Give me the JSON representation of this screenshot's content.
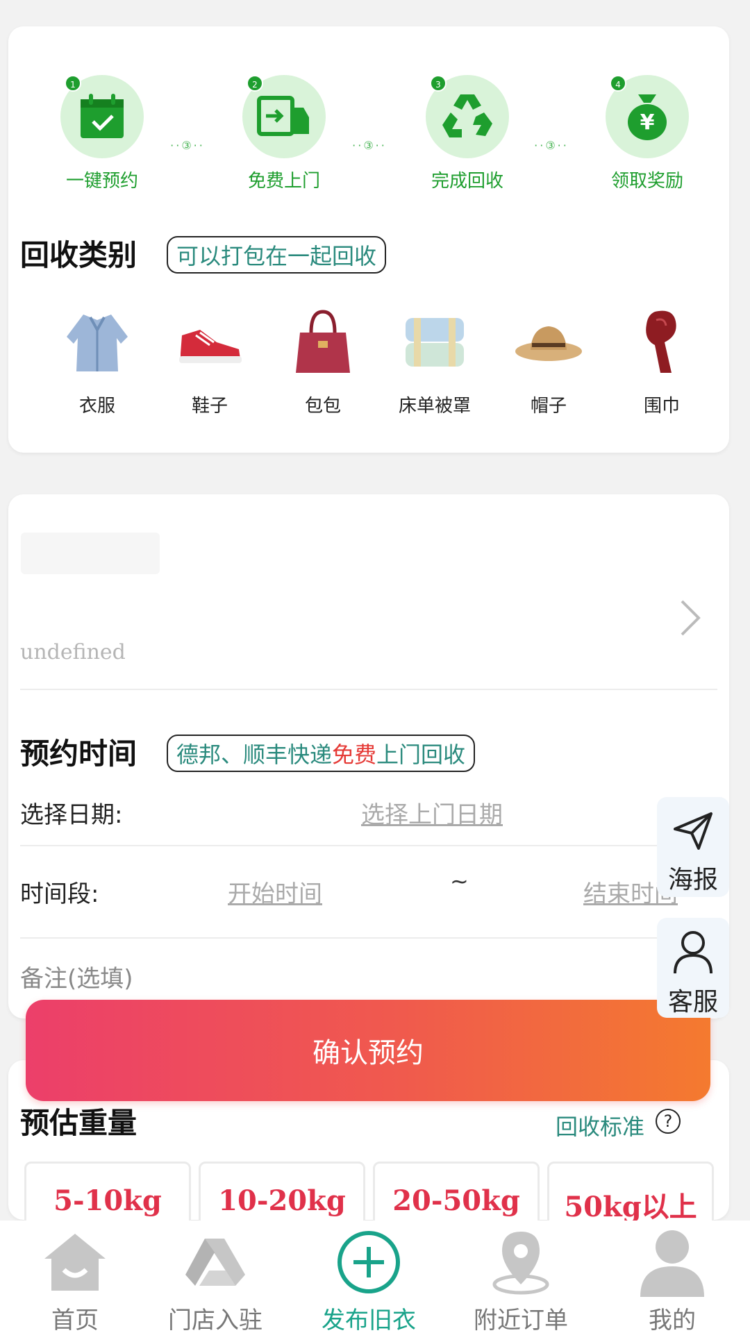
{
  "colors": {
    "accent_green": "#1e9e2e",
    "teal": "#19a38a",
    "red": "#e0314a",
    "gradient_start": "#ec3f6a",
    "gradient_end": "#f47a2f"
  },
  "steps": [
    {
      "num": "1",
      "label": "一键预约",
      "icon": "calendar-check-icon"
    },
    {
      "num": "2",
      "label": "免费上门",
      "icon": "truck-icon"
    },
    {
      "num": "3",
      "label": "完成回收",
      "icon": "recycle-icon"
    },
    {
      "num": "4",
      "label": "领取奖励",
      "icon": "money-bag-icon"
    }
  ],
  "step_connector": "··③··",
  "category": {
    "title": "回收类别",
    "note": "可以打包在一起回收",
    "items": [
      {
        "label": "衣服",
        "icon": "shirt-icon"
      },
      {
        "label": "鞋子",
        "icon": "shoe-icon"
      },
      {
        "label": "包包",
        "icon": "handbag-icon"
      },
      {
        "label": "床单被罩",
        "icon": "bedding-icon"
      },
      {
        "label": "帽子",
        "icon": "hat-icon"
      },
      {
        "label": "围巾",
        "icon": "scarf-icon"
      }
    ]
  },
  "address": {
    "detail": "undefined"
  },
  "appointment": {
    "title": "预约时间",
    "note_part1": "德邦、顺丰快递",
    "note_free": "免费",
    "note_part2": "上门回收",
    "date_label": "选择日期:",
    "date_placeholder": "选择上门日期",
    "time_label": "时间段:",
    "start_placeholder": "开始时间",
    "separator": "~",
    "end_placeholder": "结束时间",
    "remark_placeholder": "备注(选填)"
  },
  "confirm_label": "确认预约",
  "floating": {
    "poster": "海报",
    "service": "客服"
  },
  "weight": {
    "title": "预估重量",
    "standard_link": "回收标准",
    "help": "?",
    "options": [
      "5-10kg",
      "10-20kg",
      "20-50kg",
      "50kg以上"
    ]
  },
  "tabbar": [
    {
      "label": "首页",
      "icon": "home-icon"
    },
    {
      "label": "门店入驻",
      "icon": "store-icon"
    },
    {
      "label": "发布旧衣",
      "icon": "plus-circle-icon"
    },
    {
      "label": "附近订单",
      "icon": "location-pin-icon"
    },
    {
      "label": "我的",
      "icon": "user-icon"
    }
  ]
}
